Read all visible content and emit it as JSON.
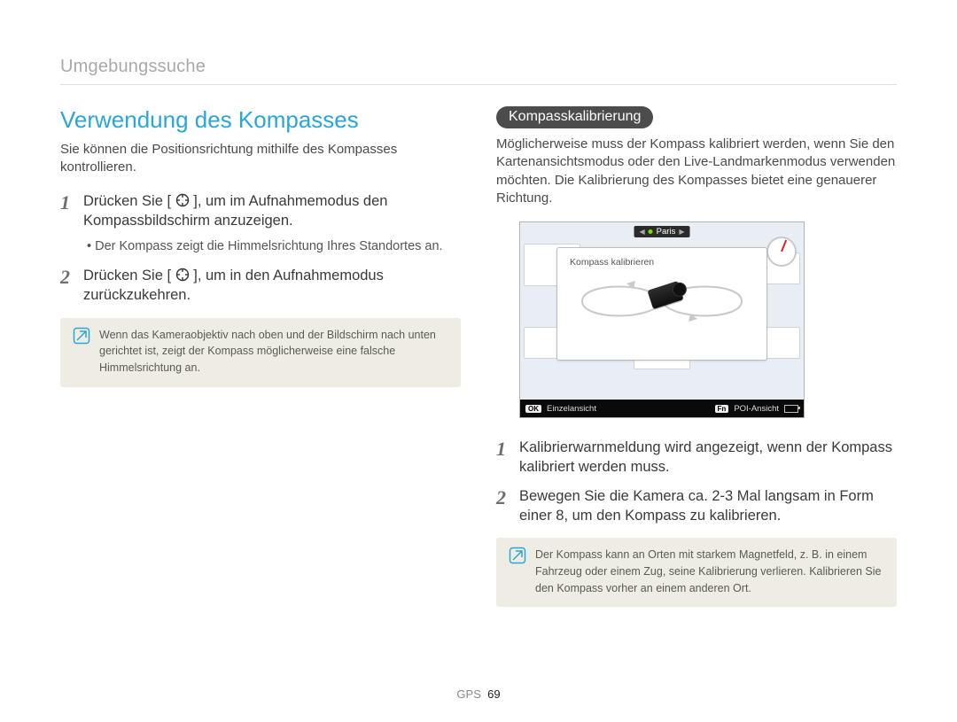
{
  "breadcrumb": "Umgebungssuche",
  "left": {
    "heading": "Verwendung des Kompasses",
    "intro": "Sie können die Positionsrichtung mithilfe des Kompasses kontrollieren.",
    "step1_a": "Drücken Sie [",
    "step1_b": "], um im Aufnahmemodus den Kompassbildschirm anzuzeigen.",
    "sub1": "Der Kompass zeigt die Himmelsrichtung Ihres Standortes an.",
    "step2_a": "Drücken Sie [",
    "step2_b": "], um in den Aufnahmemodus zurückzukehren.",
    "note": "Wenn das Kameraobjektiv nach oben und der Bildschirm nach unten gerichtet ist, zeigt der Kompass möglicherweise eine falsche Himmelsrichtung an."
  },
  "right": {
    "pill": "Kompasskalibrierung",
    "intro": "Möglicherweise muss der Kompass kalibriert werden, wenn Sie den Kartenansichtsmodus oder den Live-Landmarkenmodus verwenden möchten. Die Kalibrierung des Kompasses bietet eine genauerer Richtung.",
    "step1": "Kalibrierwarnmeldung wird angezeigt, wenn der Kompass kalibriert werden muss.",
    "step2": "Bewegen Sie die Kamera ca. 2-3 Mal langsam in Form einer 8, um den Kompass zu kalibrieren.",
    "note": "Der Kompass kann an Orten mit starkem Magnetfeld, z. B. in einem Fahrzeug oder einem Zug, seine Kalibrierung verlieren. Kalibrieren Sie den Kompass vorher an einem anderen Ort."
  },
  "screen": {
    "city": "Paris",
    "dialog_title": "Kompass kalibrieren",
    "ok_key": "OK",
    "ok_label": "Einzelansicht",
    "fn_key": "Fn",
    "fn_label": "POI-Ansicht"
  },
  "footer": {
    "section": "GPS",
    "page": "69"
  },
  "nums": {
    "one": "1",
    "two": "2"
  }
}
